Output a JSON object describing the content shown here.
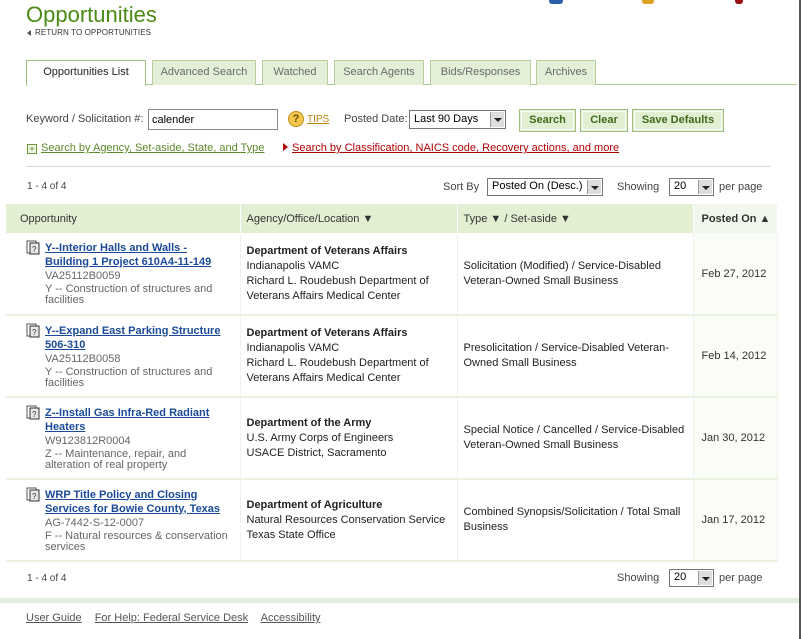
{
  "page": {
    "title": "Opportunities",
    "return_link": "RETURN TO OPPORTUNITIES"
  },
  "tabs": [
    {
      "label": "Opportunities List",
      "active": true
    },
    {
      "label": "Advanced Search",
      "active": false
    },
    {
      "label": "Watched",
      "active": false
    },
    {
      "label": "Search Agents",
      "active": false
    },
    {
      "label": "Bids/Responses",
      "active": false
    },
    {
      "label": "Archives",
      "active": false
    }
  ],
  "search": {
    "keyword_label": "Keyword / Solicitation #:",
    "keyword_value": "calender",
    "tips_label": "TIPS",
    "posted_date_label": "Posted Date:",
    "posted_date_value": "Last 90 Days",
    "search_button": "Search",
    "clear_button": "Clear",
    "save_defaults_button": "Save Defaults",
    "agency_link": "Search by Agency, Set-aside, State, and Type",
    "classification_link": "Search by Classification, NAICS code, Recovery actions, and more"
  },
  "results": {
    "count": "1 - 4 of 4",
    "sort_label": "Sort By",
    "sort_value": "Posted On (Desc.)",
    "showing_label": "Showing",
    "showing_value": "20",
    "per_page_label": "per page",
    "columns": {
      "opportunity": "Opportunity",
      "agency": "Agency/Office/Location ▼",
      "type": "Type ▼ / Set-aside ▼",
      "posted": "Posted On ▲"
    },
    "rows": [
      {
        "title": "Y--Interior Halls and Walls - Building 1 Project 610A4-11-149",
        "solicitation": "VA25112B0059",
        "classification": "Y -- Construction of structures and facilities",
        "agency": "Department of Veterans Affairs",
        "office": "Indianapolis VAMC",
        "location": "Richard L. Roudebush Department of Veterans Affairs Medical Center",
        "type": "Solicitation (Modified) / Service-Disabled Veteran-Owned Small Business",
        "posted": "Feb 27, 2012"
      },
      {
        "title": "Y--Expand East Parking Structure 506-310",
        "solicitation": "VA25112B0058",
        "classification": "Y -- Construction of structures and facilities",
        "agency": "Department of Veterans Affairs",
        "office": "Indianapolis VAMC",
        "location": "Richard L. Roudebush Department of Veterans Affairs Medical Center",
        "type": "Presolicitation / Service-Disabled Veteran-Owned Small Business",
        "posted": "Feb 14, 2012"
      },
      {
        "title": "Z--Install Gas Infra-Red Radiant Heaters",
        "solicitation": "W9123812R0004",
        "classification": "Z -- Maintenance, repair, and alteration of real property",
        "agency": "Department of the Army",
        "office": "U.S. Army Corps of Engineers",
        "location": "USACE District, Sacramento",
        "type": "Special Notice / Cancelled / Service-Disabled Veteran-Owned Small Business",
        "posted": "Jan 30, 2012"
      },
      {
        "title": "WRP Title Policy and Closing Services for Bowie County, Texas",
        "solicitation": "AG-7442-S-12-0007",
        "classification": "F -- Natural resources & conservation services",
        "agency": "Department of Agriculture",
        "office": "Natural Resources Conservation Service",
        "location": "Texas State Office",
        "type": "Combined Synopsis/Solicitation / Total Small Business",
        "posted": "Jan 17, 2012"
      }
    ]
  },
  "footer": {
    "links": [
      "User Guide",
      "For Help: Federal Service Desk",
      "Accessibility"
    ]
  },
  "colors": {
    "brand_green": "#4a8a16",
    "tab_bg": "#e3efd6",
    "header_bg": "#e2efd3",
    "link_blue": "#1a4a99",
    "alert_red": "#b00000"
  },
  "icons": [
    "doc-question-icon",
    "tips-help-icon",
    "plus-box-icon",
    "red-triangle-icon",
    "dropdown-arrow-icon"
  ]
}
